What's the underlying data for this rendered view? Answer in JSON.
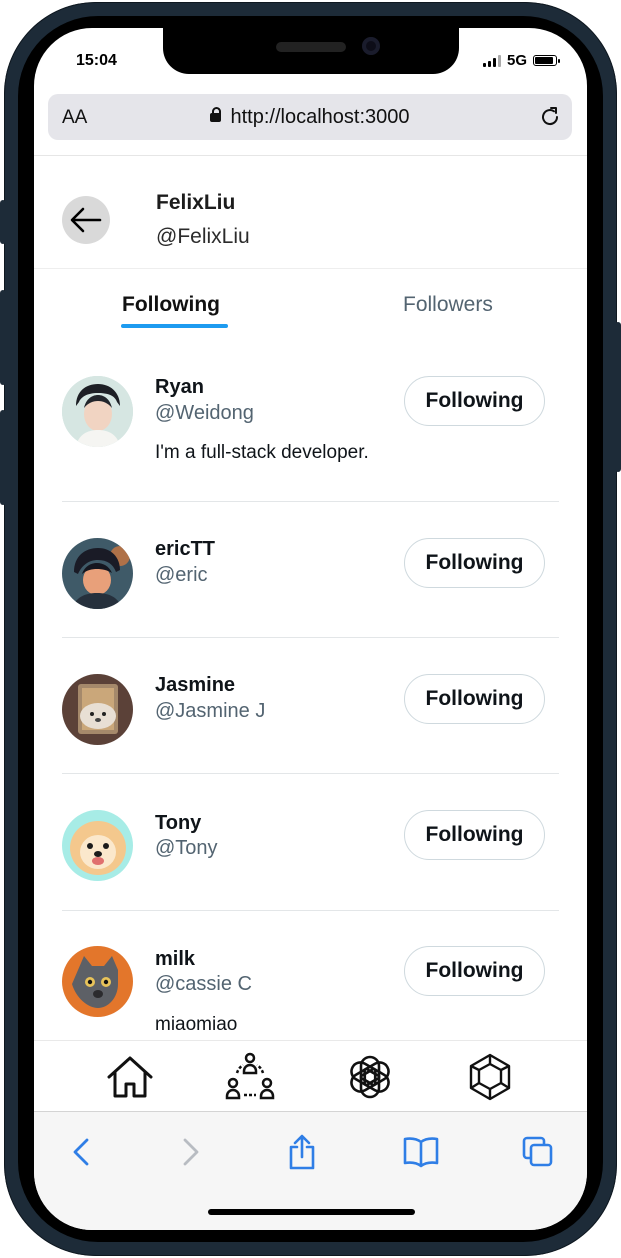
{
  "status_bar": {
    "time": "15:04",
    "network": "5G"
  },
  "browser": {
    "text_size_label": "AA",
    "url": "http://localhost:3000"
  },
  "profile": {
    "name": "FelixLiu",
    "handle": "@FelixLiu"
  },
  "tabs": [
    {
      "label": "Following",
      "active": true
    },
    {
      "label": "Followers",
      "active": false
    }
  ],
  "users": [
    {
      "name": "Ryan",
      "handle": "@Weidong",
      "bio": "I'm a full-stack developer.",
      "button": "Following"
    },
    {
      "name": "ericTT",
      "handle": "@eric",
      "bio": "",
      "button": "Following"
    },
    {
      "name": "Jasmine",
      "handle": "@Jasmine J",
      "bio": "",
      "button": "Following"
    },
    {
      "name": "Tony",
      "handle": "@Tony",
      "bio": "",
      "button": "Following"
    },
    {
      "name": "milk",
      "handle": "@cassie C",
      "bio": "miaomiao",
      "button": "Following"
    }
  ],
  "bottom_nav": [
    "home-icon",
    "community-icon",
    "openai-icon",
    "cube-icon"
  ],
  "safari_toolbar": [
    "back-icon",
    "forward-icon",
    "share-icon",
    "bookmarks-icon",
    "tabs-icon"
  ],
  "colors": {
    "accent": "#1d9bf0",
    "secondary_text": "#536471",
    "safari_blue": "#2f7ee6"
  }
}
